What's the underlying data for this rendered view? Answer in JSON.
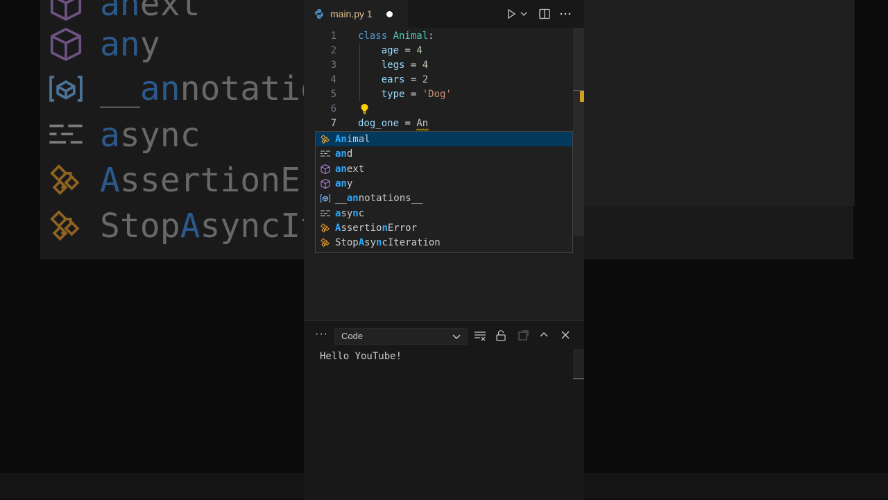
{
  "background_zoom": {
    "rows": [
      {
        "pre": "",
        "match": "an",
        "post": "ext",
        "icon": "module-icon"
      },
      {
        "pre": "",
        "match": "an",
        "post": "y",
        "icon": "module-icon"
      },
      {
        "pre": "__",
        "match": "an",
        "post": "notatio",
        "icon": "variable-icon"
      },
      {
        "pre": "",
        "match": "a",
        "post": "sync",
        "icon": "keyword-icon"
      },
      {
        "pre": "",
        "match": "A",
        "post": "ssertionEr",
        "icon": "class-icon"
      },
      {
        "pre": "Stop",
        "match": "A",
        "post": "syncIt",
        "icon": "class-icon"
      }
    ]
  },
  "tab": {
    "filename": "main.py",
    "problems": "1"
  },
  "code": {
    "line_numbers": [
      "1",
      "2",
      "3",
      "4",
      "5",
      "6",
      "7"
    ],
    "lines": [
      [
        {
          "t": "class ",
          "c": "kw"
        },
        {
          "t": "Animal",
          "c": "cls"
        },
        {
          "t": ":",
          "c": ""
        }
      ],
      [
        {
          "t": "    ",
          "c": ""
        },
        {
          "t": "age",
          "c": "var"
        },
        {
          "t": " = ",
          "c": ""
        },
        {
          "t": "4",
          "c": "num"
        }
      ],
      [
        {
          "t": "    ",
          "c": ""
        },
        {
          "t": "legs",
          "c": "var"
        },
        {
          "t": " = ",
          "c": ""
        },
        {
          "t": "4",
          "c": "num"
        }
      ],
      [
        {
          "t": "    ",
          "c": ""
        },
        {
          "t": "ears",
          "c": "var"
        },
        {
          "t": " = ",
          "c": ""
        },
        {
          "t": "2",
          "c": "num"
        }
      ],
      [
        {
          "t": "    ",
          "c": ""
        },
        {
          "t": "type",
          "c": "var"
        },
        {
          "t": " = ",
          "c": ""
        },
        {
          "t": "'Dog'",
          "c": "str"
        }
      ],
      [],
      [
        {
          "t": "dog_one",
          "c": "var"
        },
        {
          "t": " = ",
          "c": ""
        },
        {
          "t": "An",
          "c": ""
        }
      ]
    ]
  },
  "suggestions": [
    {
      "pre": "",
      "match": "An",
      "post": "imal",
      "icon": "class-icon",
      "selected": true
    },
    {
      "pre": "",
      "match": "an",
      "post": "d",
      "icon": "keyword-icon",
      "selected": false
    },
    {
      "pre": "",
      "match": "an",
      "post": "ext",
      "icon": "module-icon",
      "selected": false
    },
    {
      "pre": "",
      "match": "an",
      "post": "y",
      "icon": "module-icon",
      "selected": false
    },
    {
      "pre": "__",
      "match": "an",
      "post": "notations__",
      "icon": "variable-icon",
      "selected": false
    },
    {
      "pre": "",
      "match": "a",
      "post": "sy",
      "post2": "c",
      "match2": "n",
      "icon": "keyword-icon",
      "selected": false
    },
    {
      "pre": "",
      "match": "A",
      "post": "sertio",
      "match2": "n",
      "post2": "Error",
      "mid": "s",
      "icon": "class-icon",
      "selected": false
    },
    {
      "pre": "Stop",
      "match": "A",
      "post": "sy",
      "match2": "n",
      "post2": "cIteration",
      "icon": "class-icon",
      "selected": false
    }
  ],
  "panel": {
    "more": "···",
    "output_channel": "Code",
    "output_text": "Hello YouTube!"
  },
  "colors": {
    "accent": "#2aaaff",
    "selection": "#04395e",
    "modified_tab": "#e2c08d",
    "lightbulb": "#ffcc00"
  }
}
